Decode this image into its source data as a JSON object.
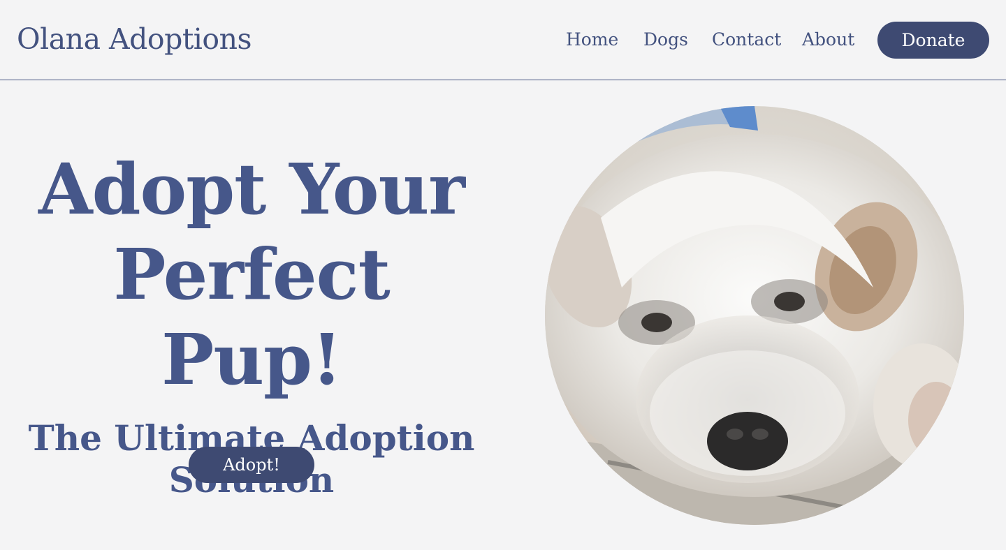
{
  "brand": {
    "name": "Olana Adoptions"
  },
  "nav": {
    "items": [
      "Home",
      "Dogs",
      "Contact",
      "About"
    ],
    "donate_label": "Donate"
  },
  "hero": {
    "headline": "Adopt Your Perfect Pup!",
    "subheadline": "The Ultimate Adoption Solution",
    "cta_label": "Adopt!"
  },
  "colors": {
    "background": "#f4f4f5",
    "brand_text": "#43527f",
    "button_bg": "#3e4a72",
    "button_text": "#ffffff"
  },
  "image": {
    "subject": "dog-photo"
  }
}
